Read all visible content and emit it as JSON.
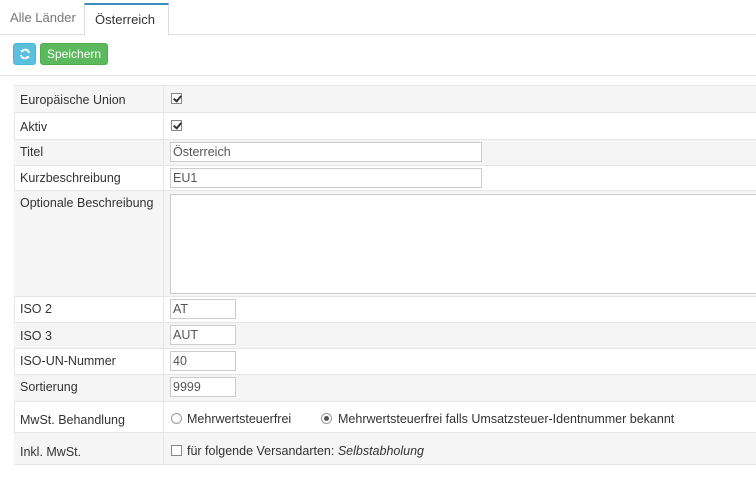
{
  "tabs": [
    {
      "label": "Alle Länder",
      "active": false
    },
    {
      "label": "Österreich",
      "active": true
    }
  ],
  "toolbar": {
    "refresh_icon": "refresh-icon",
    "save_label": "Speichern"
  },
  "colors": {
    "refresh_button": "#5bc0de",
    "save_button": "#5cb85c",
    "active_tab_accent": "#3c8dbc"
  },
  "form": {
    "eu": {
      "label": "Europäische Union",
      "checked": true
    },
    "active": {
      "label": "Aktiv",
      "checked": true
    },
    "title": {
      "label": "Titel",
      "value": "Österreich"
    },
    "short": {
      "label": "Kurzbeschreibung",
      "value": "EU1"
    },
    "desc": {
      "label": "Optionale Beschreibung",
      "value": ""
    },
    "iso2": {
      "label": "ISO 2",
      "value": "AT"
    },
    "iso3": {
      "label": "ISO 3",
      "value": "AUT"
    },
    "isoun": {
      "label": "ISO-UN-Nummer",
      "value": "40"
    },
    "sort": {
      "label": "Sortierung",
      "value": "9999"
    },
    "vat": {
      "label": "MwSt. Behandlung",
      "options": [
        {
          "label": "Mehrwertsteuerfrei",
          "selected": false
        },
        {
          "label": "Mehrwertsteuerfrei falls Umsatzsteuer-Identnummer bekannt",
          "selected": true
        }
      ]
    },
    "inclvat": {
      "label": "Inkl. MwSt.",
      "checked": false,
      "text": "für folgende Versandarten:",
      "italic_text": "Selbstabholung"
    }
  }
}
